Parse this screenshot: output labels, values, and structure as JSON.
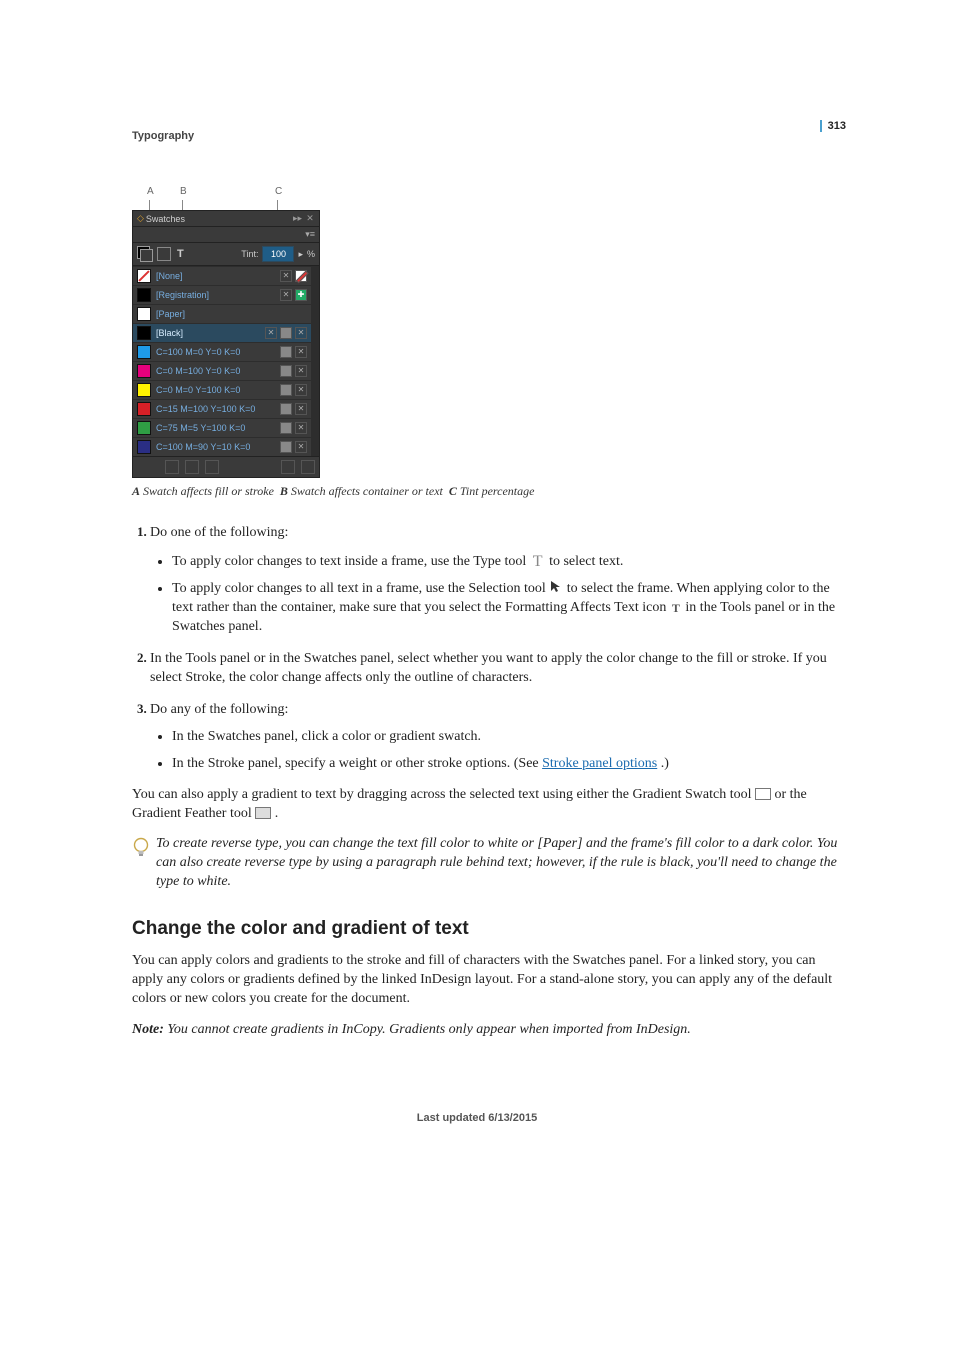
{
  "page_number": "313",
  "chapter": "Typography",
  "panel": {
    "callouts": {
      "A": "A",
      "B": "B",
      "C": "C"
    },
    "title": "Swatches",
    "tint_label": "Tint:",
    "tint_value": "100",
    "tint_suffix": "%",
    "rows": [
      {
        "name": "[None]",
        "chipClass": "none-chip",
        "sel": false,
        "right": [
          "x",
          "/"
        ]
      },
      {
        "name": "[Registration]",
        "chipClass": "reg-chip",
        "sel": false,
        "right": [
          "x",
          "+"
        ]
      },
      {
        "name": "[Paper]",
        "chipColor": "#ffffff",
        "sel": false,
        "right": []
      },
      {
        "name": "[Black]",
        "chipColor": "#000000",
        "sel": true,
        "right": [
          "x",
          "g",
          "x"
        ]
      },
      {
        "name": "C=100 M=0 Y=0 K=0",
        "chipColor": "#1e9be9",
        "sel": false,
        "right": [
          "g",
          "x"
        ]
      },
      {
        "name": "C=0 M=100 Y=0 K=0",
        "chipColor": "#e5007d",
        "sel": false,
        "right": [
          "g",
          "x"
        ]
      },
      {
        "name": "C=0 M=0 Y=100 K=0",
        "chipColor": "#fff200",
        "sel": false,
        "right": [
          "g",
          "x"
        ]
      },
      {
        "name": "C=15 M=100 Y=100 K=0",
        "chipColor": "#d62027",
        "sel": false,
        "right": [
          "g",
          "x"
        ]
      },
      {
        "name": "C=75 M=5 Y=100 K=0",
        "chipColor": "#2f9e44",
        "sel": false,
        "right": [
          "g",
          "x"
        ]
      },
      {
        "name": "C=100 M=90 Y=10 K=0",
        "chipColor": "#2a2e84",
        "sel": false,
        "right": [
          "g",
          "x"
        ]
      }
    ]
  },
  "figcap": {
    "A_lbl": "A",
    "A_txt": "Swatch affects fill or stroke",
    "B_lbl": "B",
    "B_txt": "Swatch affects container or text",
    "C_lbl": "C",
    "C_txt": "Tint percentage"
  },
  "steps": {
    "s1_intro": "Do one of the following:",
    "s1_b1_a": "To apply color changes to text inside a frame, use the Type tool ",
    "s1_b1_b": " to select text.",
    "s1_b2_a": "To apply color changes to all text in a frame, use the Selection tool ",
    "s1_b2_b": " to select the frame. When applying color to the text rather than the container, make sure that you select the Formatting Affects Text icon ",
    "s1_b2_c": " in the Tools panel or in the Swatches panel.",
    "s2": "In the Tools panel or in the Swatches panel, select whether you want to apply the color change to the fill or stroke. If you select Stroke, the color change affects only the outline of characters.",
    "s3_intro": "Do any of the following:",
    "s3_b1": "In the Swatches panel, click a color or gradient swatch.",
    "s3_b2_a": "In the Stroke panel, specify a weight or other stroke options. (See ",
    "s3_b2_link": "Stroke panel options",
    "s3_b2_b": " .)"
  },
  "after_a": "You can also apply a gradient to text by dragging across the selected text using either the Gradient Swatch tool ",
  "after_b": " or the Gradient Feather tool ",
  "after_c": " .",
  "tip": "To create reverse type, you can change the text fill color to white or [Paper] and the frame's fill color to a dark color. You can also create reverse type by using a paragraph rule behind text; however, if the rule is black, you'll need to change the type to white.",
  "section2_heading": "Change the color and gradient of text",
  "section2_body": "You can apply colors and gradients to the stroke and fill of characters with the Swatches panel. For a linked story, you can apply any colors or gradients defined by the linked InDesign layout. For a stand-alone story, you can apply any of the default colors or new colors you create for the document.",
  "note_label": "Note:",
  "note_body": " You cannot create gradients in InCopy. Gradients only appear when imported from InDesign.",
  "footer": "Last updated 6/13/2015"
}
